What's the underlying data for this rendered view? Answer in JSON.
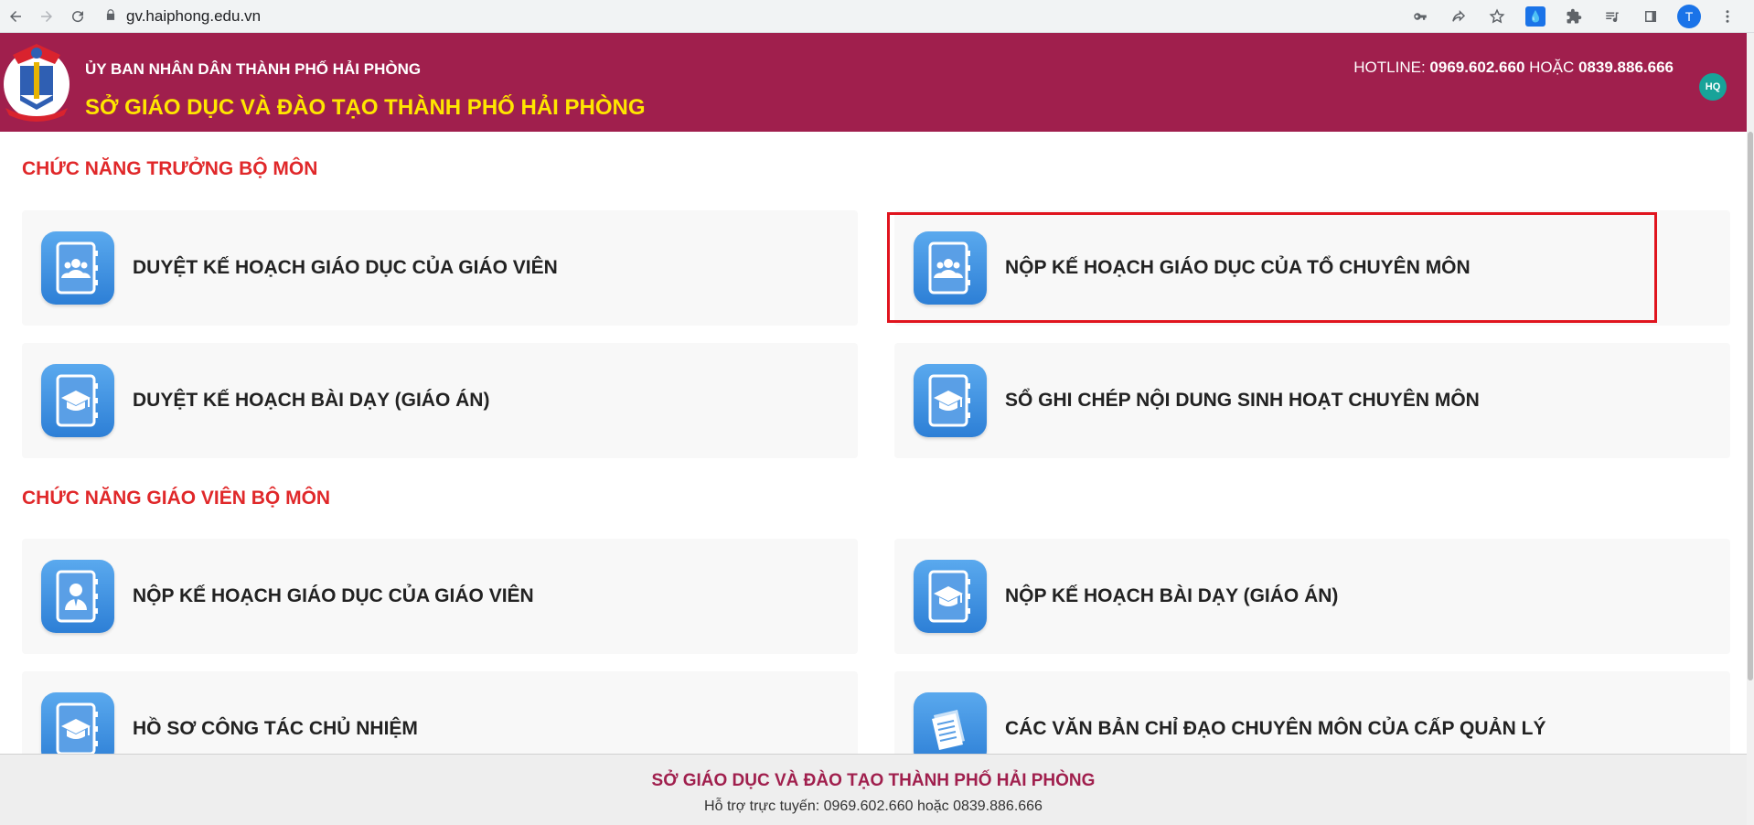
{
  "browser": {
    "url": "gv.haiphong.edu.vn",
    "profile_initial": "T"
  },
  "header": {
    "org": "ỦY BAN NHÂN DÂN THÀNH PHỐ HẢI PHÒNG",
    "dept": "SỞ GIÁO DỤC VÀ ĐÀO TẠO THÀNH PHỐ HẢI PHÒNG",
    "hotline_label": "HOTLINE:",
    "hotline_1": "0969.602.660",
    "hotline_or": "HOẶC",
    "hotline_2": "0839.886.666",
    "user_badge": "HQ"
  },
  "sections": {
    "head_title": "CHỨC NĂNG TRƯỞNG BỘ MÔN",
    "teacher_title": "CHỨC NĂNG GIÁO VIÊN BỘ MÔN"
  },
  "cards": {
    "c1": "DUYỆT KẾ HOẠCH GIÁO DỤC CỦA GIÁO VIÊN",
    "c2": "NỘP KẾ HOẠCH GIÁO DỤC CỦA TỔ CHUYÊN MÔN",
    "c3": "DUYỆT KẾ HOẠCH BÀI DẠY (GIÁO ÁN)",
    "c4": "SỔ GHI CHÉP NỘI DUNG SINH HOẠT CHUYÊN MÔN",
    "c5": "NỘP KẾ HOẠCH GIÁO DỤC CỦA GIÁO VIÊN",
    "c6": "NỘP KẾ HOẠCH BÀI DẠY (GIÁO ÁN)",
    "c7": "HỒ SƠ CÔNG TÁC CHỦ NHIỆM",
    "c8": "CÁC VĂN BẢN CHỈ ĐẠO CHUYÊN MÔN CỦA CẤP QUẢN LÝ"
  },
  "footer": {
    "title": "SỞ GIÁO DỤC VÀ ĐÀO TẠO THÀNH PHỐ HẢI PHÒNG",
    "support": "Hỗ trợ trực tuyến: 0969.602.660 hoặc 0839.886.666"
  },
  "colors": {
    "header_bg": "#a01f4d",
    "dept_text": "#ffe600",
    "section_title": "#e0282a",
    "highlight_border": "#e0141e"
  }
}
